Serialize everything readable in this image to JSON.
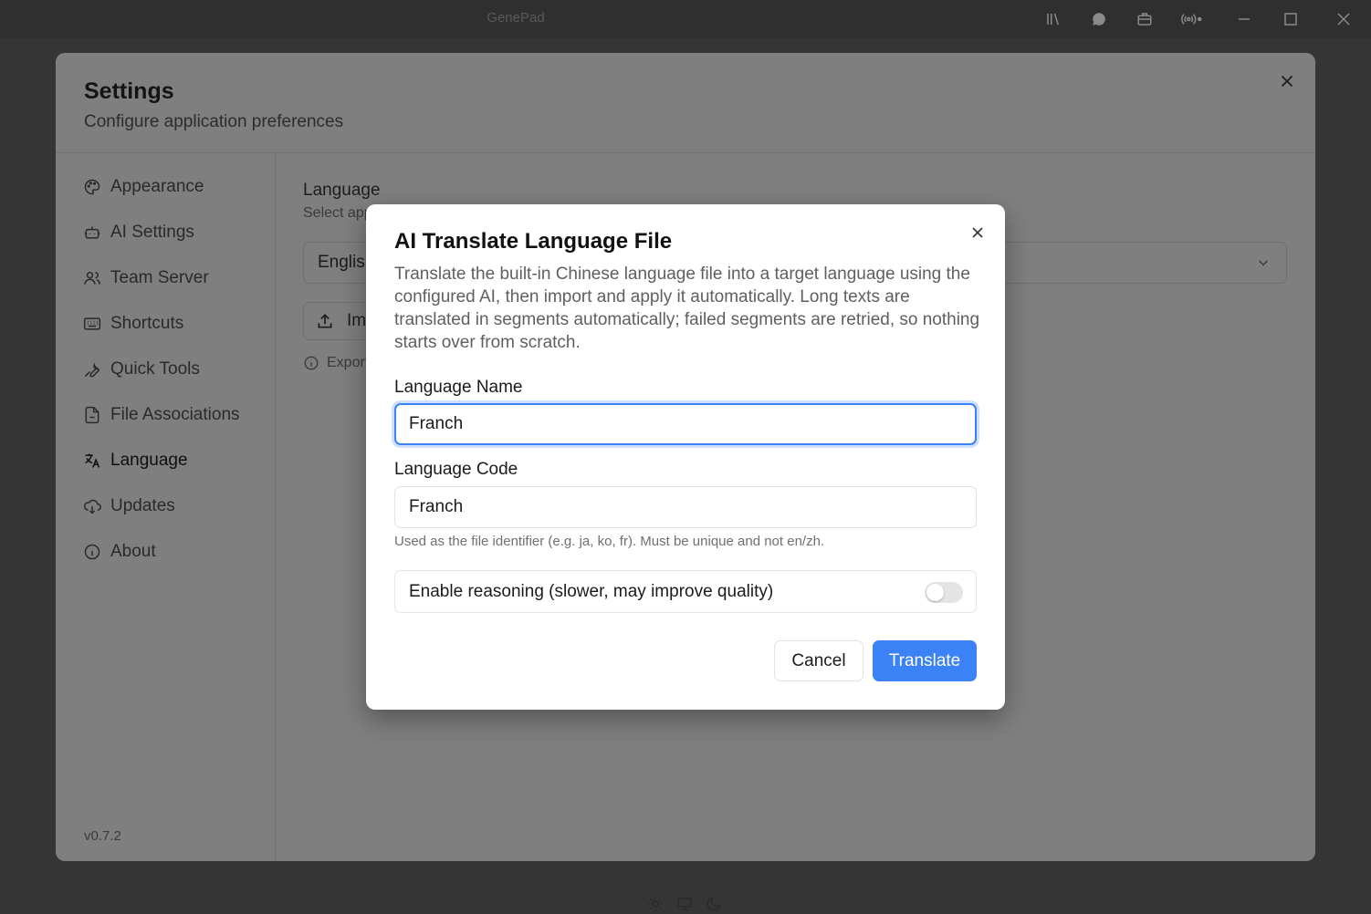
{
  "window": {
    "title": "GenePad",
    "toolbar_icons": [
      "library-icon",
      "chat-icon",
      "briefcase-icon",
      "broadcast-icon"
    ],
    "bottom_icons": [
      "sun-icon",
      "monitor-icon",
      "moon-icon"
    ]
  },
  "settings": {
    "title": "Settings",
    "subtitle": "Configure application preferences",
    "nav": [
      {
        "label": "Appearance",
        "icon": "palette-icon"
      },
      {
        "label": "AI Settings",
        "icon": "bot-icon"
      },
      {
        "label": "Team Server",
        "icon": "users-icon"
      },
      {
        "label": "Shortcuts",
        "icon": "keyboard-icon"
      },
      {
        "label": "Quick Tools",
        "icon": "wrench-icon"
      },
      {
        "label": "File Associations",
        "icon": "file-link-icon"
      },
      {
        "label": "Language",
        "icon": "translate-icon",
        "active": true
      },
      {
        "label": "Updates",
        "icon": "cloud-download-icon"
      },
      {
        "label": "About",
        "icon": "info-icon"
      }
    ],
    "version": "v0.7.2",
    "language": {
      "heading": "Language",
      "description": "Select app",
      "selected": "English",
      "import_label": "Im",
      "export_note": "Export"
    }
  },
  "dialog": {
    "title": "AI Translate Language File",
    "description": "Translate the built-in Chinese language file into a target language using the configured AI, then import and apply it automatically. Long texts are translated in segments automatically; failed segments are retried, so nothing starts over from scratch.",
    "name_label": "Language Name",
    "name_value": "Franch",
    "code_label": "Language Code",
    "code_value": "Franch",
    "code_hint": "Used as the file identifier (e.g. ja, ko, fr). Must be unique and not en/zh.",
    "reasoning_label": "Enable reasoning (slower, may improve quality)",
    "reasoning_enabled": false,
    "cancel_label": "Cancel",
    "translate_label": "Translate",
    "accent_color": "#3b82f6"
  }
}
